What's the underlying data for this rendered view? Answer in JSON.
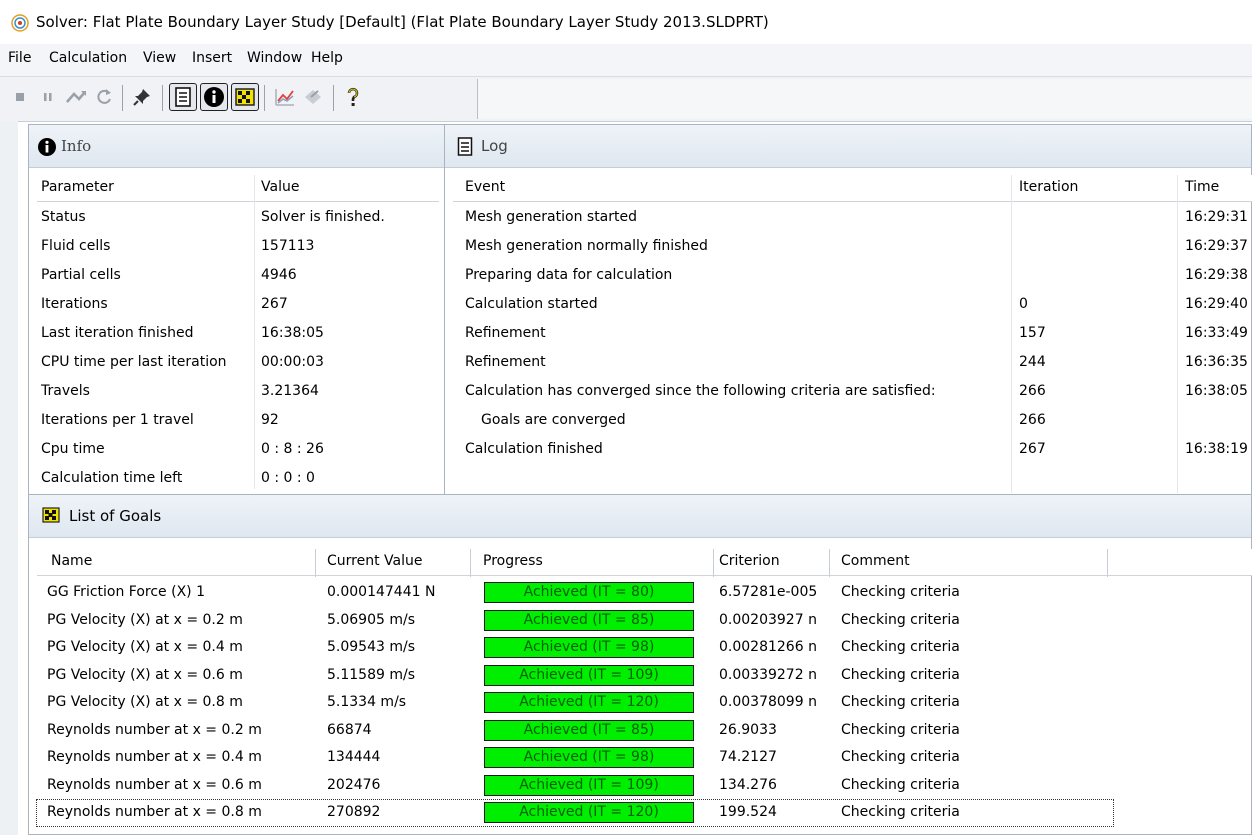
{
  "window": {
    "title": "Solver: Flat Plate Boundary Layer Study [Default] (Flat Plate Boundary Layer Study 2013.SLDPRT)",
    "icon": "solver-app-icon"
  },
  "menu": [
    "File",
    "Calculation",
    "View",
    "Insert",
    "Window",
    "Help"
  ],
  "toolbar": {
    "buttons": [
      "stop-icon",
      "pause-icon",
      "continue-icon",
      "refresh-icon",
      "pin-icon",
      "log-icon",
      "info-icon",
      "goals-icon",
      "plot-icon",
      "preview-icon",
      "help-icon"
    ],
    "pressed": [
      "log-icon",
      "info-icon",
      "goals-icon"
    ]
  },
  "info": {
    "title": "Info",
    "headers": [
      "Parameter",
      "Value"
    ],
    "rows": [
      [
        "Status",
        "Solver is finished."
      ],
      [
        "Fluid cells",
        "157113"
      ],
      [
        "Partial cells",
        "4946"
      ],
      [
        "Iterations",
        "267"
      ],
      [
        "Last iteration finished",
        "16:38:05"
      ],
      [
        "CPU time per last iteration",
        "00:00:03"
      ],
      [
        "Travels",
        "3.21364"
      ],
      [
        "Iterations per 1 travel",
        "92"
      ],
      [
        "Cpu time",
        "0 : 8 : 26"
      ],
      [
        "Calculation time left",
        "0 : 0 : 0"
      ]
    ]
  },
  "log": {
    "title": "Log",
    "headers": [
      "Event",
      "Iteration",
      "Time"
    ],
    "rows": [
      [
        "Mesh generation started",
        "",
        "16:29:31"
      ],
      [
        "Mesh generation normally finished",
        "",
        "16:29:37"
      ],
      [
        "Preparing data for calculation",
        "",
        "16:29:38"
      ],
      [
        "Calculation started",
        "0",
        "16:29:40"
      ],
      [
        "Refinement",
        "157",
        "16:33:49"
      ],
      [
        "Refinement",
        "244",
        "16:36:35"
      ],
      [
        "Calculation has converged since the following criteria are satisfied:",
        "266",
        "16:38:05"
      ],
      [
        "Goals are converged",
        "266",
        ""
      ],
      [
        "Calculation finished",
        "267",
        "16:38:19"
      ]
    ]
  },
  "goals": {
    "title": "List of Goals",
    "headers": [
      "Name",
      "Current Value",
      "Progress",
      "Criterion",
      "Comment"
    ],
    "rows": [
      [
        "GG Friction Force (X) 1",
        "0.000147441 N",
        "Achieved (IT = 80)",
        "6.57281e-005",
        "Checking criteria"
      ],
      [
        "PG Velocity (X) at x = 0.2 m",
        "5.06905 m/s",
        "Achieved (IT = 85)",
        "0.00203927 n",
        "Checking criteria"
      ],
      [
        "PG Velocity (X) at x = 0.4 m",
        "5.09543 m/s",
        "Achieved (IT = 98)",
        "0.00281266 n",
        "Checking criteria"
      ],
      [
        "PG Velocity (X) at x = 0.6 m",
        "5.11589 m/s",
        "Achieved (IT = 109)",
        "0.00339272 n",
        "Checking criteria"
      ],
      [
        "PG Velocity (X) at x = 0.8 m",
        "5.1334 m/s",
        "Achieved (IT = 120)",
        "0.00378099 n",
        "Checking criteria"
      ],
      [
        "Reynolds number at x = 0.2 m",
        "66874",
        "Achieved (IT = 85)",
        "26.9033",
        "Checking criteria"
      ],
      [
        "Reynolds number at x = 0.4 m",
        "134444",
        "Achieved (IT = 98)",
        "74.2127",
        "Checking criteria"
      ],
      [
        "Reynolds number at x = 0.6 m",
        "202476",
        "Achieved (IT = 109)",
        "134.276",
        "Checking criteria"
      ],
      [
        "Reynolds number at x = 0.8 m",
        "270892",
        "Achieved (IT = 120)",
        "199.524",
        "Checking criteria"
      ]
    ],
    "progress_color": "#00ee00"
  }
}
